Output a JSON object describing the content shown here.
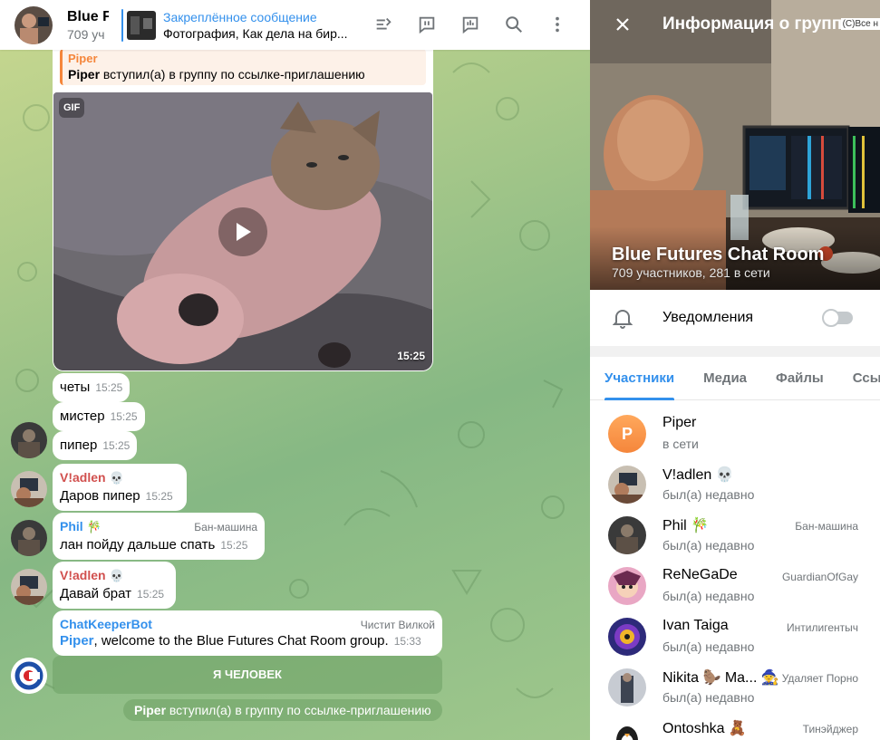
{
  "chat": {
    "title": "Blue F",
    "subtitle": "709 уч",
    "pinned": {
      "title": "Закреплённое сообщение",
      "body": "Фотография, Как дела на бир..."
    },
    "top_message": {
      "sender": "Piper",
      "name": "Piper",
      "text": " вступил(а) в группу по ссылке-приглашению"
    },
    "gif": {
      "badge": "GIF",
      "time": "15:25"
    },
    "messages": [
      {
        "text": "четы",
        "time": "15:25"
      },
      {
        "text": "мистер",
        "time": "15:25"
      },
      {
        "text": "пипер",
        "time": "15:25"
      },
      {
        "sender": "V!adlen",
        "emoji": "💀",
        "text": "Даров пипер",
        "time": "15:25"
      },
      {
        "sender": "Phil",
        "emoji": "🎋",
        "role": "Бан-машина",
        "text": "лан пойду дальше спать",
        "time": "15:25"
      },
      {
        "sender": "V!adlen",
        "emoji": "💀",
        "text": "Давай брат",
        "time": "15:25"
      },
      {
        "sender": "ChatKeeperBot",
        "role": "Чистит Вилкой",
        "name": "Piper",
        "text": ", welcome to the Blue Futures Chat Room group.",
        "time": "15:33"
      }
    ],
    "bot_button": "Я ЧЕЛОВЕК",
    "service": {
      "name": "Piper",
      "text": " вступил(а) в группу по ссылке-приглашению"
    }
  },
  "panel": {
    "title": "Информация о группе",
    "corner_text": "(C)Все н",
    "group_name": "Blue Futures Chat Room",
    "group_stats": "709 участников, 281 в сети",
    "notifications_label": "Уведомления",
    "notifications_on": false,
    "tabs": [
      "Участники",
      "Медиа",
      "Файлы",
      "Ссы"
    ],
    "members": [
      {
        "name": "Piper",
        "status": "в сети",
        "role": "",
        "letter": "P"
      },
      {
        "name": "V!adlen 💀",
        "status": "был(а) недавно",
        "role": ""
      },
      {
        "name": "Phil 🎋",
        "status": "был(а) недавно",
        "role": "Бан-машина"
      },
      {
        "name": "ReNeGaDe",
        "status": "был(а) недавно",
        "role": "GuardianOfGay"
      },
      {
        "name": "Ivan Taiga",
        "status": "был(а) недавно",
        "role": "Интилигентыч"
      },
      {
        "name": "Nikita 🦫 Ma... 🧙",
        "status": "был(а) недавно",
        "role": "Удаляет Порно"
      },
      {
        "name": "Ontoshka 🧸",
        "status": "",
        "role": "Тинэйджер"
      }
    ]
  },
  "colors": {
    "accent": "#3390ec",
    "sender_red": "#d1504e",
    "pinned_line": "#3390ec"
  }
}
